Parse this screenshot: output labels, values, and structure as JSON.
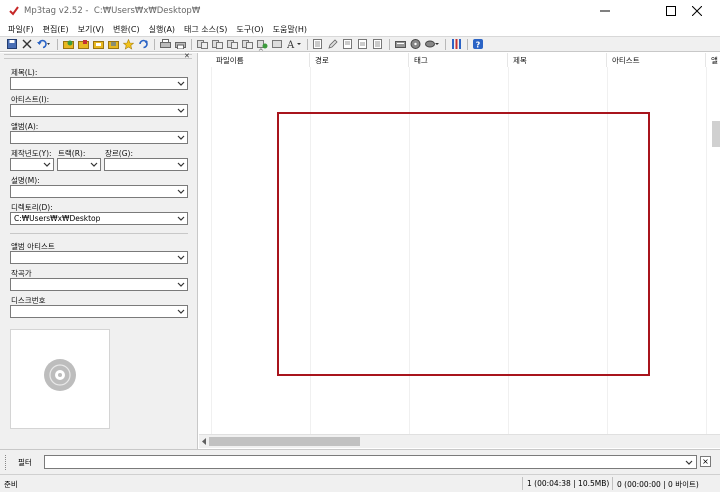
{
  "window": {
    "app_name": "Mp3tag v2.52",
    "path": "C:₩Users₩x₩Desktop₩"
  },
  "menu": [
    "파일(F)",
    "편집(E)",
    "보기(V)",
    "변환(C)",
    "실행(A)",
    "태그 소스(S)",
    "도구(O)",
    "도움말(H)"
  ],
  "toolbar": {
    "icons": [
      "save-icon",
      "remove-tag-icon",
      "undo-icon",
      "folder-open-icon",
      "folder-add-icon",
      "folder-sub-icon",
      "playlist-icon",
      "favorites-icon",
      "refresh-icon",
      "print-icon",
      "convert-tag-icon",
      "filename-tag-icon",
      "tag-filename-icon",
      "text-tag-icon",
      "tag-tag-icon",
      "case-conversion-icon",
      "text-editor-icon",
      "edit-icon",
      "export-icon",
      "import-icon",
      "actions-icon",
      "tag-source-icon",
      "settings-icon",
      "help-icon"
    ],
    "colors": {
      "accent": "#2a63c5",
      "green": "#3c9a3c",
      "yellow": "#e8b820",
      "red": "#c43232"
    }
  },
  "tag_panel": {
    "title_label": "제목(L):",
    "artist_label": "아티스트(I):",
    "album_label": "앨범(A):",
    "year_label": "제작년도(Y):",
    "track_label": "트랙(R):",
    "genre_label": "장르(G):",
    "comment_label": "설명(M):",
    "directory_label": "디렉토리(D):",
    "directory_value": "C:₩Users₩x₩Desktop",
    "album_artist_label": "앨범 아티스트",
    "composer_label": "작곡가",
    "disc_label": "디스크번호"
  },
  "file_list": {
    "columns": [
      "파일이름",
      "경로",
      "태그",
      "제목",
      "아티스트"
    ],
    "overflow_column": "앨"
  },
  "filter": {
    "label": "필터",
    "value": ""
  },
  "status": {
    "left": "준비",
    "selected": "1 (00:04:38 | 10.5MB)",
    "total": "0 (00:00:00 | 0 바이트)"
  },
  "highlight_color": "#a8141c"
}
